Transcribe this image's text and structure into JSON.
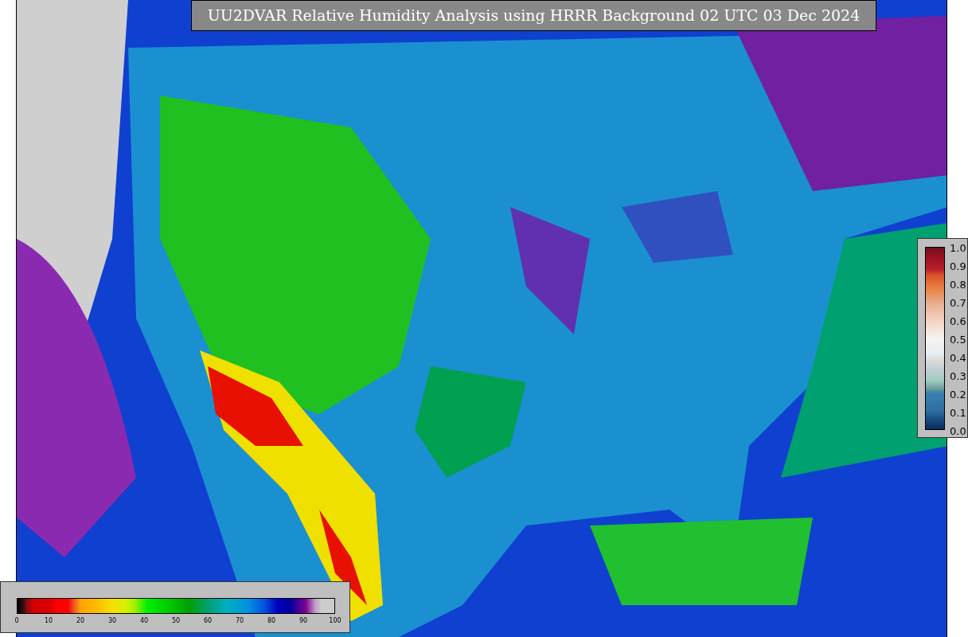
{
  "title": "UU2DVAR Relative Humidity Analysis using HRRR Background 02 UTC 03 Dec 2024",
  "humidity_colorbar": {
    "ticks": [
      "0",
      "10",
      "20",
      "30",
      "40",
      "50",
      "60",
      "70",
      "80",
      "90",
      "100"
    ]
  },
  "ratio_colorbar": {
    "ticks": [
      "1.0",
      "0.9",
      "0.8",
      "0.7",
      "0.6",
      "0.5",
      "0.4",
      "0.3",
      "0.2",
      "0.1",
      "0.0"
    ]
  }
}
